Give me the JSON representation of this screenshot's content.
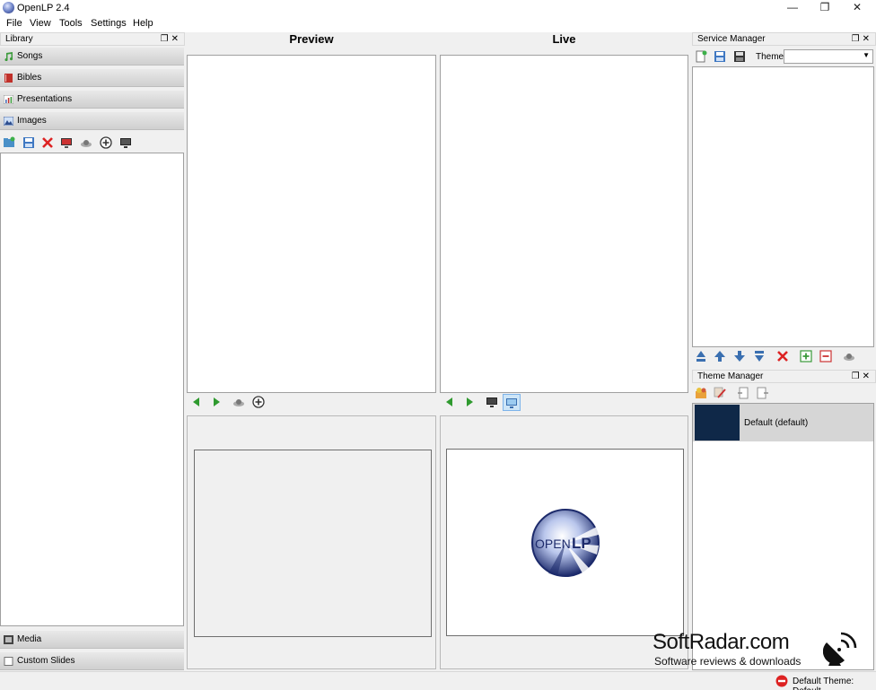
{
  "window": {
    "title": "OpenLP 2.4"
  },
  "menubar": {
    "items": [
      "File",
      "View",
      "Tools",
      "Settings",
      "Help"
    ]
  },
  "library": {
    "header": "Library",
    "sections_top": [
      {
        "label": "Songs",
        "icon": "music-note-icon",
        "color": "#3d9b3d"
      },
      {
        "label": "Bibles",
        "icon": "bible-icon",
        "color": "#c0302a"
      },
      {
        "label": "Presentations",
        "icon": "presentation-icon",
        "color": "#4a6fb5"
      },
      {
        "label": "Images",
        "icon": "images-icon",
        "color": "#5a78b6"
      }
    ],
    "sections_bottom": [
      {
        "label": "Media",
        "icon": "film-icon"
      },
      {
        "label": "Custom Slides",
        "icon": "custom-slide-icon"
      }
    ]
  },
  "preview": {
    "title": "Preview"
  },
  "live": {
    "title": "Live"
  },
  "service_manager": {
    "header": "Service Manager",
    "theme_label": "Theme:",
    "theme_value": ""
  },
  "theme_manager": {
    "header": "Theme Manager",
    "items": [
      {
        "label": "Default (default)"
      }
    ]
  },
  "status": {
    "text": "Default Theme: Default"
  },
  "watermark": {
    "brand": "SoftRadar.com",
    "tagline": "Software reviews & downloads"
  },
  "logo": {
    "text_open": "OPEN",
    "text_lp": "LP"
  }
}
